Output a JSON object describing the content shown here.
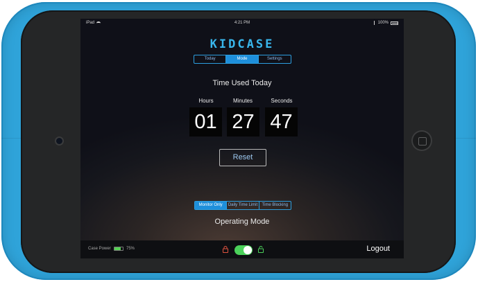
{
  "status_bar": {
    "device": "iPad",
    "time": "4:21 PM",
    "battery": "100%"
  },
  "app": {
    "logo": "KIDCASE"
  },
  "tabs": [
    {
      "label": "Today",
      "active": false
    },
    {
      "label": "Mode",
      "active": true
    },
    {
      "label": "Settings",
      "active": false
    }
  ],
  "main": {
    "title": "Time Used Today",
    "hours_label": "Hours",
    "minutes_label": "Minutes",
    "seconds_label": "Seconds",
    "hours": "01",
    "minutes": "27",
    "seconds": "47",
    "reset_label": "Reset"
  },
  "modes": [
    {
      "label": "Monitor Only",
      "active": true
    },
    {
      "label": "Daily Time Limit",
      "active": false
    },
    {
      "label": "Time Blocking",
      "active": false
    }
  ],
  "operating_mode_label": "Operating Mode",
  "bottom_bar": {
    "case_power_label": "Case Power",
    "case_power_percent": "75%",
    "case_power_level": 0.75,
    "lock_toggle_on": true,
    "logout_label": "Logout"
  },
  "colors": {
    "accent": "#1e8fdb",
    "case": "#2fa3d9",
    "toggle_on": "#4bd15a",
    "lock_open": "#4bd15a",
    "lock_closed": "#e0533f"
  },
  "icons": [
    "wifi-icon",
    "bluetooth-icon",
    "battery-icon",
    "lock-closed-icon",
    "lock-open-icon",
    "camera-icon",
    "home-button-icon"
  ]
}
